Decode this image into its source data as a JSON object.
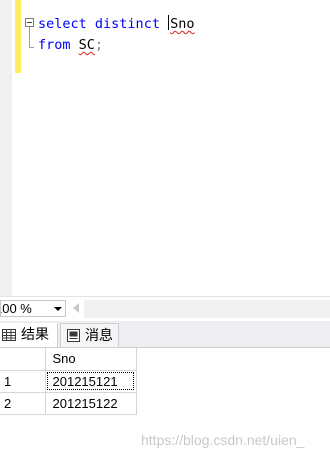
{
  "editor": {
    "line1": {
      "keyword1": "select",
      "keyword2": "distinct",
      "identifier": "Sno"
    },
    "line2": {
      "keyword": "from",
      "identifier": "SC",
      "terminator": ";"
    }
  },
  "status_bar": {
    "zoom_level": "100 %"
  },
  "results_tabs": [
    {
      "label": "结果",
      "icon": "grid-icon",
      "selected": true
    },
    {
      "label": "消息",
      "icon": "message-icon",
      "selected": false
    }
  ],
  "results_grid": {
    "columns": [
      "Sno"
    ],
    "rows": [
      {
        "row_number": "1",
        "Sno": "201215121"
      },
      {
        "row_number": "2",
        "Sno": "201215122"
      }
    ]
  },
  "watermark": "https://blog.csdn.net/uien_"
}
